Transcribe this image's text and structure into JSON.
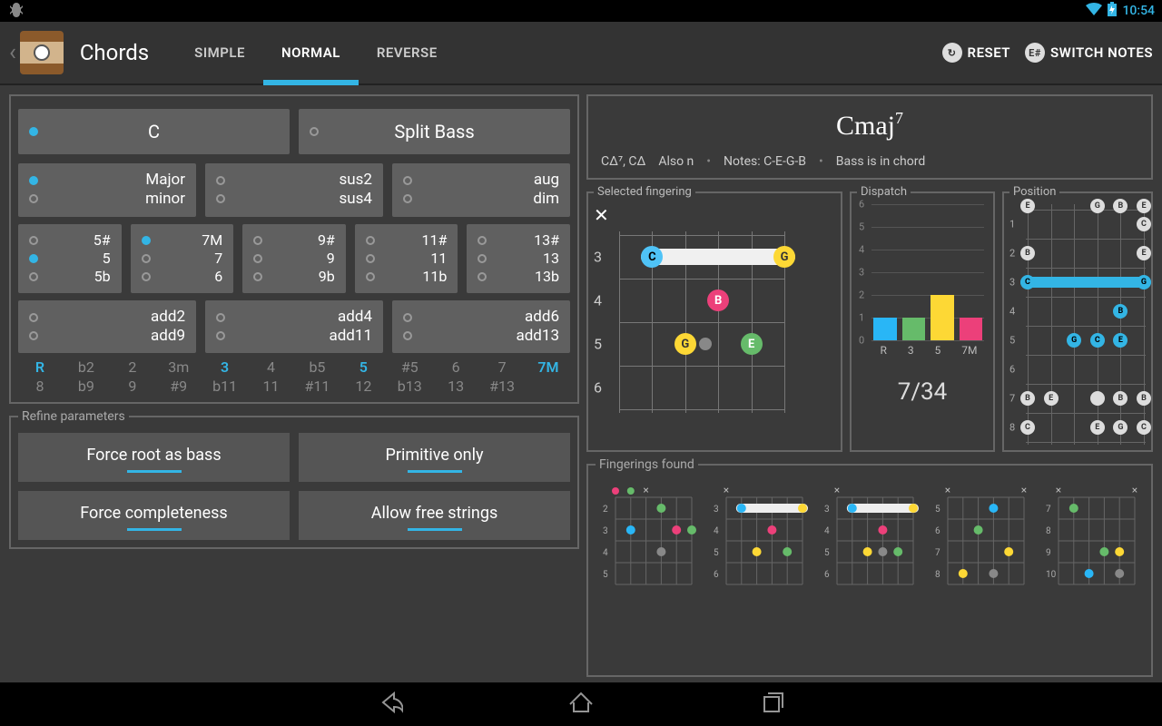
{
  "statusbar": {
    "time": "10:54"
  },
  "appbar": {
    "title": "Chords",
    "tabs": [
      "SIMPLE",
      "NORMAL",
      "REVERSE"
    ],
    "active_tab": 1,
    "reset": "RESET",
    "switch_notes": "SWITCH NOTES",
    "switch_notes_icon": "E#"
  },
  "root": {
    "note": "C",
    "split_bass": "Split Bass"
  },
  "quality": {
    "group1": [
      "Major",
      "minor"
    ],
    "group2": [
      "sus2",
      "sus4"
    ],
    "group3": [
      "aug",
      "dim"
    ]
  },
  "ext": {
    "c1": [
      "5#",
      "5",
      "5b"
    ],
    "c2": [
      "7M",
      "7",
      "6"
    ],
    "c3": [
      "9#",
      "9",
      "9b"
    ],
    "c4": [
      "11#",
      "11",
      "11b"
    ],
    "c5": [
      "13#",
      "13",
      "13b"
    ]
  },
  "add": {
    "c1": [
      "add2",
      "add9"
    ],
    "c2": [
      "add4",
      "add11"
    ],
    "c3": [
      "add6",
      "add13"
    ]
  },
  "degrees": [
    {
      "top": "R",
      "bottom": "8",
      "on": true
    },
    {
      "top": "b2",
      "bottom": "b9",
      "on": false
    },
    {
      "top": "2",
      "bottom": "9",
      "on": false
    },
    {
      "top": "3m",
      "bottom": "#9",
      "on": false
    },
    {
      "top": "3",
      "bottom": "b11",
      "on": true
    },
    {
      "top": "4",
      "bottom": "11",
      "on": false
    },
    {
      "top": "b5",
      "bottom": "#11",
      "on": false
    },
    {
      "top": "5",
      "bottom": "12",
      "on": true
    },
    {
      "top": "#5",
      "bottom": "b13",
      "on": false
    },
    {
      "top": "6",
      "bottom": "13",
      "on": false
    },
    {
      "top": "7",
      "bottom": "#13",
      "on": false
    },
    {
      "top": "7M",
      "bottom": "",
      "on": true
    }
  ],
  "refine": {
    "legend": "Refine parameters",
    "b1": "Force root as bass",
    "b2": "Primitive only",
    "b3": "Force completeness",
    "b4": "Allow free strings"
  },
  "chord": {
    "name_base": "Cmaj",
    "name_sup": "7",
    "alt": "CΔ⁷, CΔ",
    "also": "Also n",
    "notes_label": "Notes: C-E-G-B",
    "bass_label": "Bass is in chord"
  },
  "selected": {
    "legend": "Selected fingering",
    "frets": [
      "3",
      "4",
      "5",
      "6"
    ],
    "muted_string": 1,
    "bar_from": 2,
    "bar_to": 6,
    "notes": [
      {
        "string": 2,
        "row": 0,
        "n": "C"
      },
      {
        "string": 6,
        "row": 0,
        "n": "G"
      },
      {
        "string": 4,
        "row": 1,
        "n": "B"
      },
      {
        "string": 3,
        "row": 2,
        "n": "G"
      },
      {
        "string": 5,
        "row": 2,
        "n": "E"
      }
    ],
    "finger_dot": {
      "string": 3.6,
      "row": 2
    }
  },
  "dispatch": {
    "legend": "Dispatch",
    "ylabels": [
      "6",
      "5",
      "4",
      "3",
      "2",
      "1",
      "0"
    ],
    "counter": "7/34"
  },
  "chart_data": {
    "type": "bar",
    "categories": [
      "R",
      "3",
      "5",
      "7M"
    ],
    "values": [
      1,
      1,
      2,
      1
    ],
    "colors": [
      "#29B6F6",
      "#66BB6A",
      "#FDD835",
      "#EC407A"
    ],
    "ylim": [
      0,
      6
    ],
    "title": "Dispatch"
  },
  "position": {
    "legend": "Position",
    "frets": [
      "1",
      "2",
      "3",
      "4",
      "5",
      "6",
      "7",
      "8"
    ]
  },
  "fingerings": {
    "legend": "Fingerings found",
    "start_frets": [
      "2",
      "3",
      "3",
      "5",
      "7"
    ]
  }
}
